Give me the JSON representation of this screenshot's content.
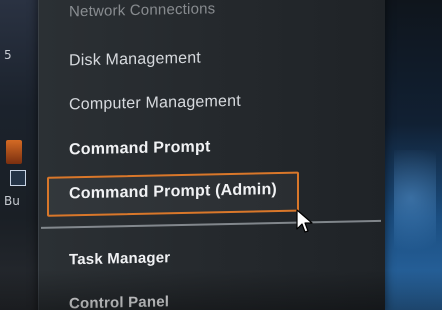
{
  "desktop": {
    "left_top_text": "5",
    "left_bottom_text": "Bu"
  },
  "menu": {
    "items": [
      {
        "label": "Network Connections"
      },
      {
        "label": "Disk Management"
      },
      {
        "label": "Computer Management"
      },
      {
        "label": "Command Prompt"
      },
      {
        "label": "Command Prompt (Admin)"
      },
      {
        "label": "Task Manager"
      },
      {
        "label": "Control Panel"
      }
    ],
    "highlight_color": "#d9772a"
  },
  "icons": {
    "cursor": "mouse-pointer-icon"
  }
}
